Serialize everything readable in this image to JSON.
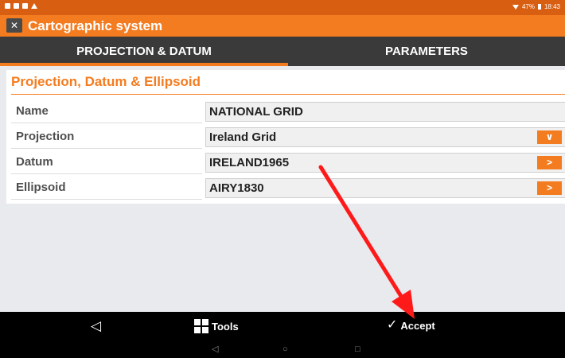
{
  "status_bar": {
    "battery": "47%",
    "time": "18:43"
  },
  "app": {
    "logo_glyph": "✕",
    "title": "Cartographic system"
  },
  "tabs": [
    {
      "label": "PROJECTION & DATUM",
      "active": true
    },
    {
      "label": "PARAMETERS",
      "active": false
    }
  ],
  "section": {
    "title": "Projection, Datum & Ellipsoid"
  },
  "fields": [
    {
      "label": "Name",
      "value": "NATIONAL GRID"
    },
    {
      "label": "Projection",
      "value": "Ireland Grid",
      "button_icon": "chevron-down-icon",
      "button_glyph": "∨"
    },
    {
      "label": "Datum",
      "value": "IRELAND1965",
      "button_icon": "chevron-right-icon",
      "button_glyph": ">"
    },
    {
      "label": "Ellipsoid",
      "value": "AIRY1830",
      "button_icon": "chevron-right-icon",
      "button_glyph": ">"
    }
  ],
  "toolbar": {
    "back_glyph": "◁",
    "tools_label": "Tools",
    "accept_glyph": "✓",
    "accept_label": "Accept"
  },
  "nav": {
    "back_glyph": "◁",
    "home_glyph": "○",
    "recents_glyph": "□"
  },
  "colors": {
    "accent": "#f47c20",
    "status_bar": "#d85f12",
    "tab_bar": "#3a3a3a",
    "annotation_arrow": "#ff1a1a"
  }
}
